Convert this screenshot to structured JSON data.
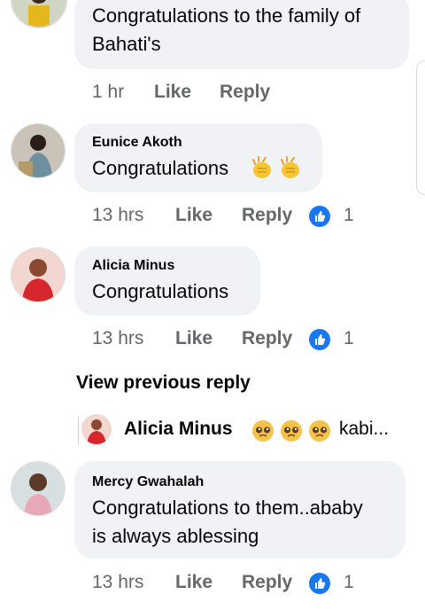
{
  "comments": [
    {
      "author": "",
      "text_lines": [
        "Congratulations to the family of",
        "Bahati's"
      ],
      "time": "1 hr",
      "like_label": "Like",
      "reply_label": "Reply",
      "reactions": ""
    },
    {
      "author": "Eunice Akoth",
      "text": "Congratulations",
      "emoji": "clapping-hands",
      "time": "13 hrs",
      "like_label": "Like",
      "reply_label": "Reply",
      "reactions": "1"
    },
    {
      "author": "Alicia Minus",
      "text": "Congratulations",
      "time": "13 hrs",
      "like_label": "Like",
      "reply_label": "Reply",
      "reactions": "1"
    },
    {
      "author": "Mercy Gwahalah",
      "text_lines": [
        "Congratulations to them..ababy",
        "is always ablessing"
      ],
      "time": "13 hrs",
      "like_label": "Like",
      "reply_label": "Reply",
      "reactions": "1"
    }
  ],
  "view_previous_reply": "View previous reply",
  "reply_preview": {
    "author": "Alicia Minus",
    "emoji": "pleading-face",
    "text": "kabi..."
  },
  "colors": {
    "bubble": "#f0f2f5",
    "meta": "#65676b",
    "like_blue": "#1877f2"
  }
}
